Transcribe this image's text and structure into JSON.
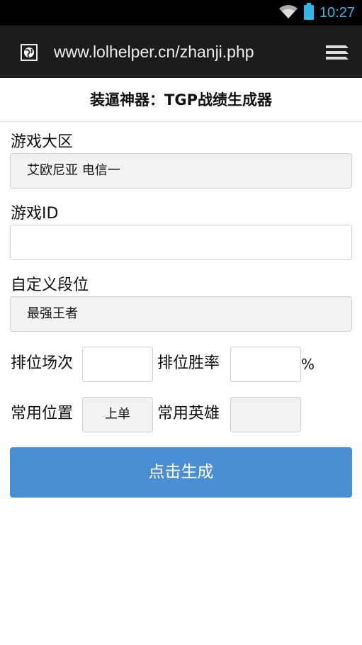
{
  "status_bar": {
    "time": "10:27"
  },
  "browser": {
    "url": "www.lolhelper.cn/zhanji.php"
  },
  "page": {
    "title": "装逼神器：TGP战绩生成器"
  },
  "form": {
    "region": {
      "label": "游戏大区",
      "value": "艾欧尼亚 电信一"
    },
    "game_id": {
      "label": "游戏ID",
      "value": ""
    },
    "rank": {
      "label": "自定义段位",
      "value": "最强王者"
    },
    "ranked_games": {
      "label": "排位场次",
      "value": ""
    },
    "win_rate": {
      "label": "排位胜率",
      "value": "",
      "unit": "%"
    },
    "position": {
      "label": "常用位置",
      "value": "上单"
    },
    "hero": {
      "label": "常用英雄",
      "value": ""
    },
    "submit_label": "点击生成"
  },
  "colors": {
    "accent": "#4a8fd4",
    "status_accent": "#33b5e5"
  }
}
